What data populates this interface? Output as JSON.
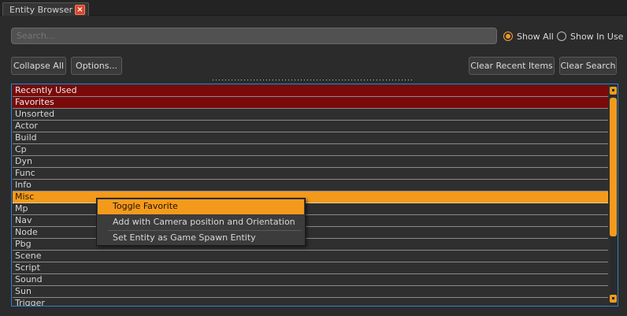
{
  "tab": {
    "title": "Entity Browser",
    "close_label": "×"
  },
  "search": {
    "placeholder": "Search...",
    "value": ""
  },
  "filters": {
    "show_all": {
      "label": "Show All",
      "checked": true
    },
    "show_in_use": {
      "label": "Show In Use",
      "checked": false
    }
  },
  "toolbar": {
    "collapse_all": "Collapse All",
    "options": "Options...",
    "clear_recent": "Clear Recent Items",
    "clear_search": "Clear Search"
  },
  "list": {
    "rows": [
      {
        "label": "Recently Used",
        "state": "fav"
      },
      {
        "label": "Favorites",
        "state": "fav"
      },
      {
        "label": "Unsorted",
        "state": ""
      },
      {
        "label": "Actor",
        "state": ""
      },
      {
        "label": "Build",
        "state": ""
      },
      {
        "label": "Cp",
        "state": ""
      },
      {
        "label": "Dyn",
        "state": ""
      },
      {
        "label": "Func",
        "state": ""
      },
      {
        "label": "Info",
        "state": ""
      },
      {
        "label": "Misc",
        "state": "selected"
      },
      {
        "label": "Mp",
        "state": ""
      },
      {
        "label": "Nav",
        "state": ""
      },
      {
        "label": "Node",
        "state": ""
      },
      {
        "label": "Pbg",
        "state": ""
      },
      {
        "label": "Scene",
        "state": ""
      },
      {
        "label": "Script",
        "state": ""
      },
      {
        "label": "Sound",
        "state": ""
      },
      {
        "label": "Sun",
        "state": ""
      },
      {
        "label": "Trigger",
        "state": ""
      }
    ]
  },
  "context_menu": {
    "items": [
      {
        "label": "Toggle Favorite",
        "highlighted": true
      },
      {
        "label": "Add with Camera position and Orientation",
        "highlighted": false
      },
      {
        "label": "Set Entity as Game Spawn Entity",
        "highlighted": false
      }
    ]
  },
  "colors": {
    "accent": "#f39a1c",
    "favorite_row": "#7a0a0a",
    "focus_border": "#2f7fd0"
  }
}
